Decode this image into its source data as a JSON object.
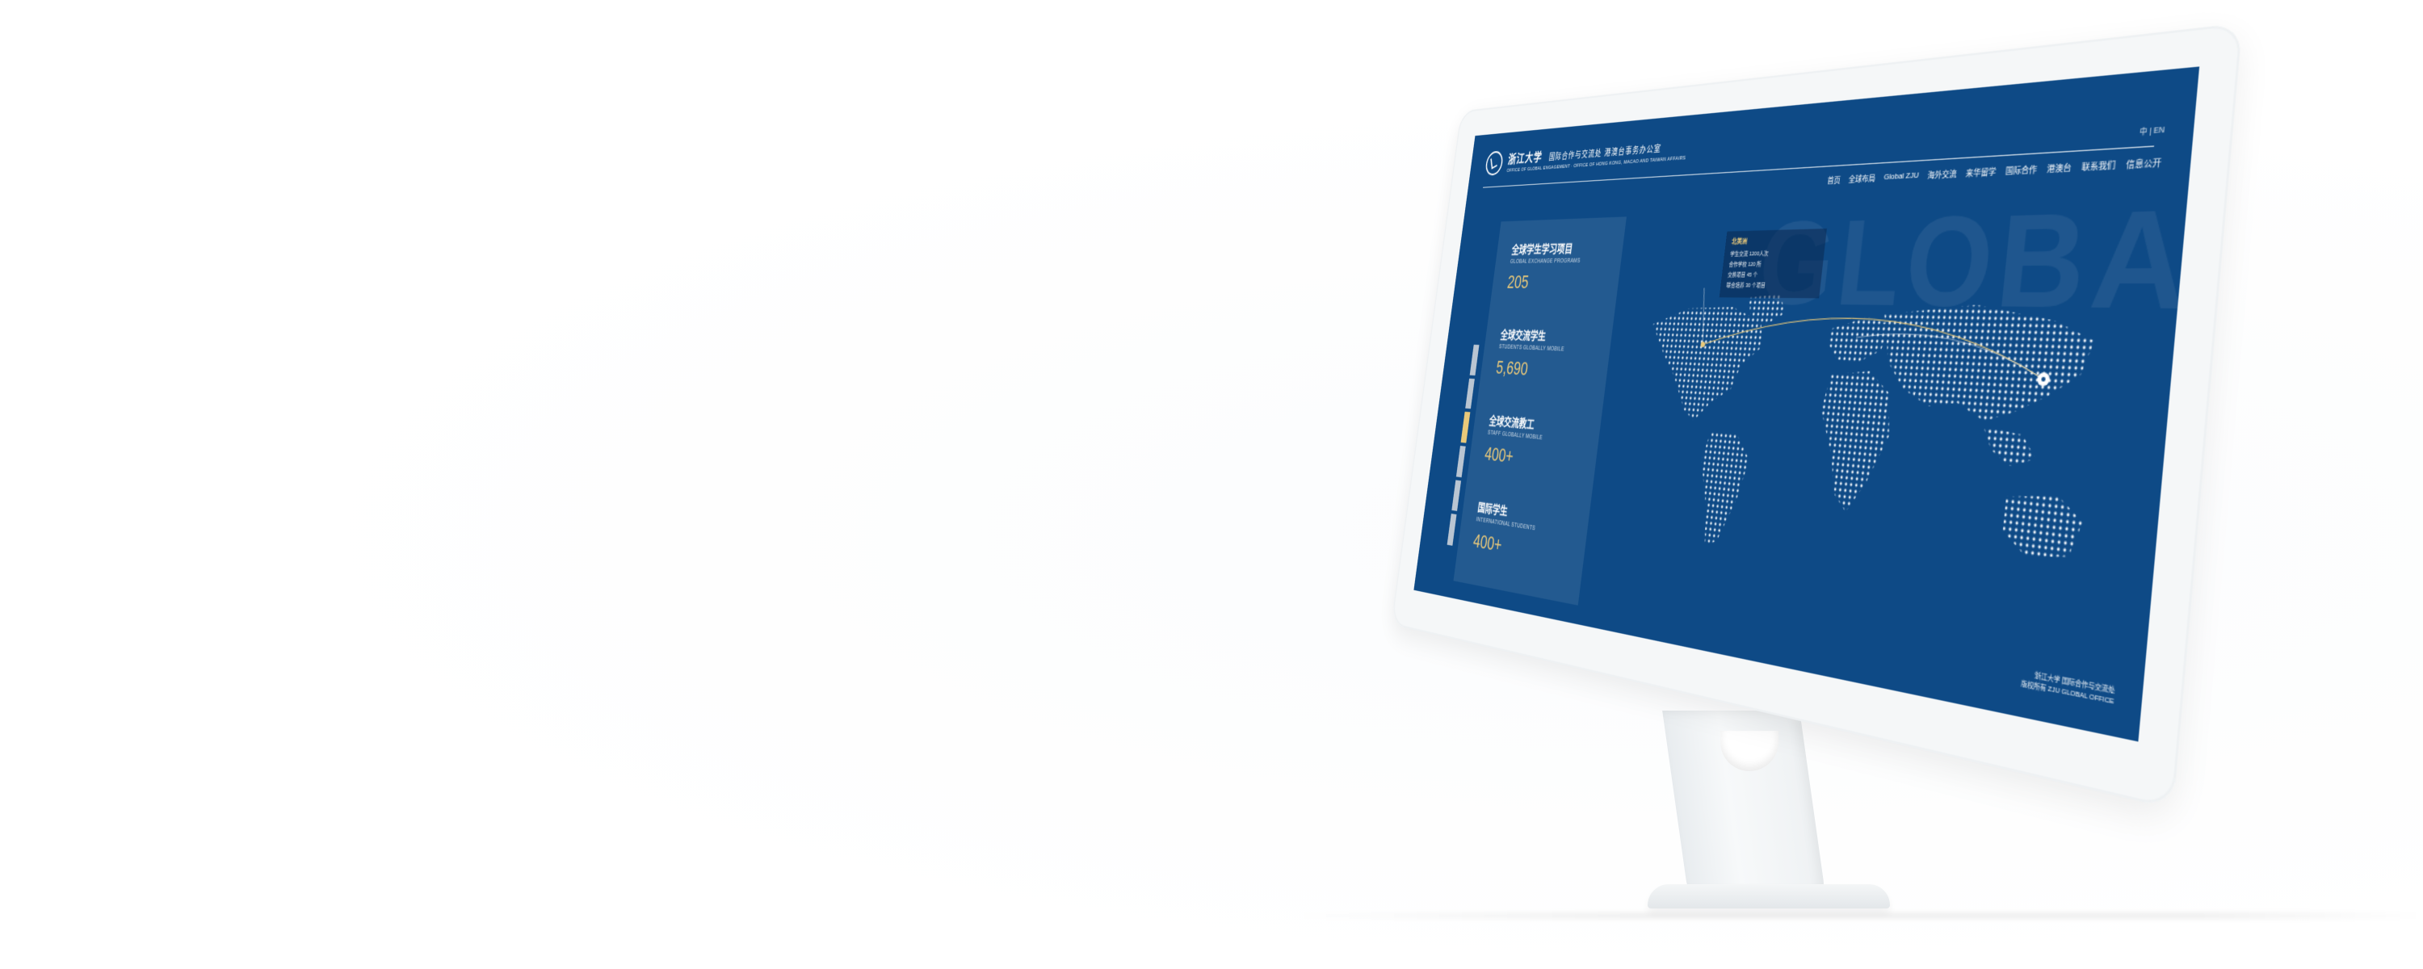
{
  "header": {
    "university_name": "浙江大学",
    "office_name": "国际合作与交流处 港澳台事务办公室",
    "office_name_en": "OFFICE OF GLOBAL ENGAGEMENT · OFFICE OF HONG KONG, MACAO AND TAIWAN AFFAIRS",
    "language_switch": "中 | EN",
    "nav": [
      "首页",
      "全球布局",
      "Global ZJU",
      "海外交流",
      "来华留学",
      "国际合作",
      "港澳台",
      "联系我们",
      "信息公开"
    ]
  },
  "watermark": "GLOBAL ZJU",
  "stats": [
    {
      "label_cn": "全球学生学习项目",
      "label_en": "GLOBAL EXCHANGE PROGRAMS",
      "value": "205"
    },
    {
      "label_cn": "全球交流学生",
      "label_en": "STUDENTS GLOBALLY MOBILE",
      "value": "5,690"
    },
    {
      "label_cn": "全球交流教工",
      "label_en": "STAFF GLOBALLY MOBILE",
      "value": "400+"
    },
    {
      "label_cn": "国际学生",
      "label_en": "INTERNATIONAL STUDENTS",
      "value": "400+"
    }
  ],
  "side_tabs": {
    "count": 6,
    "active_index": 2
  },
  "tooltip": {
    "title": "北美洲",
    "lines": [
      "学生交流 1200人次",
      "合作学校 120 所",
      "交换项目 45 个",
      "联合培养 30 个项目"
    ]
  },
  "footer": {
    "line1": "浙江大学 国际合作与交流处",
    "line2": "版权所有 ZJU GLOBAL OFFICE"
  },
  "colors": {
    "screen_bg": "#0e4a86",
    "accent_gold": "#e9c97a",
    "map_dots": "#dfe8f1"
  },
  "icons": [
    "university-logo-icon",
    "map-pin-icon"
  ]
}
